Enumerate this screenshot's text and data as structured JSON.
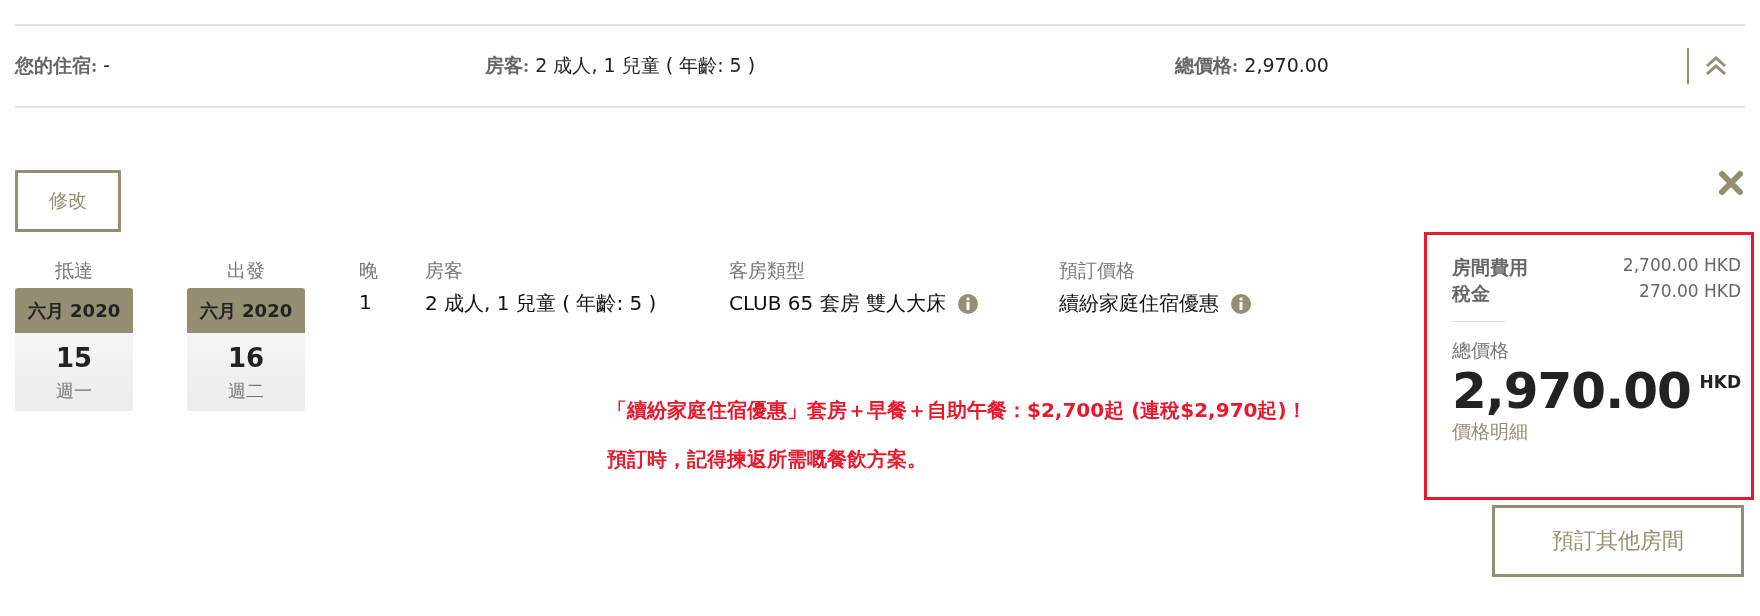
{
  "summary": [
    {
      "label": "您的住宿:",
      "value": "-"
    },
    {
      "label": "房客:",
      "value": "2 成人, 1 兒童 ( 年齡: 5 )"
    },
    {
      "label": "總價格:",
      "value": "2,970.00"
    }
  ],
  "modify_button": "修改",
  "dates": [
    {
      "label": "抵達",
      "month": "六月 2020",
      "day": "15",
      "weekday": "週一"
    },
    {
      "label": "出發",
      "month": "六月 2020",
      "day": "16",
      "weekday": "週二"
    }
  ],
  "details": [
    {
      "label": "晚",
      "value": "1",
      "has_info": false
    },
    {
      "label": "房客",
      "value": "2 成人, 1 兒童 ( 年齡: 5 )",
      "has_info": false
    },
    {
      "label": "客房類型",
      "value": "CLUB 65 套房 雙人大床",
      "has_info": true
    },
    {
      "label": "預訂價格",
      "value": "續紛家庭住宿優惠",
      "has_info": true
    }
  ],
  "promo": [
    "「續紛家庭住宿優惠」套房＋早餐＋自助午餐：$2,700起 (連稅$2,970起)！",
    "預訂時，記得揀返所需嘅餐飲方案。"
  ],
  "price_panel": {
    "lines": [
      {
        "label": "房間費用",
        "value": "2,700.00 HKD"
      },
      {
        "label": "稅金",
        "value": "270.00 HKD"
      }
    ],
    "total_label": "總價格",
    "total": "2,970.00",
    "currency": "HKD",
    "breakdown_link": "價格明細"
  },
  "book_other_button": "預訂其他房間"
}
